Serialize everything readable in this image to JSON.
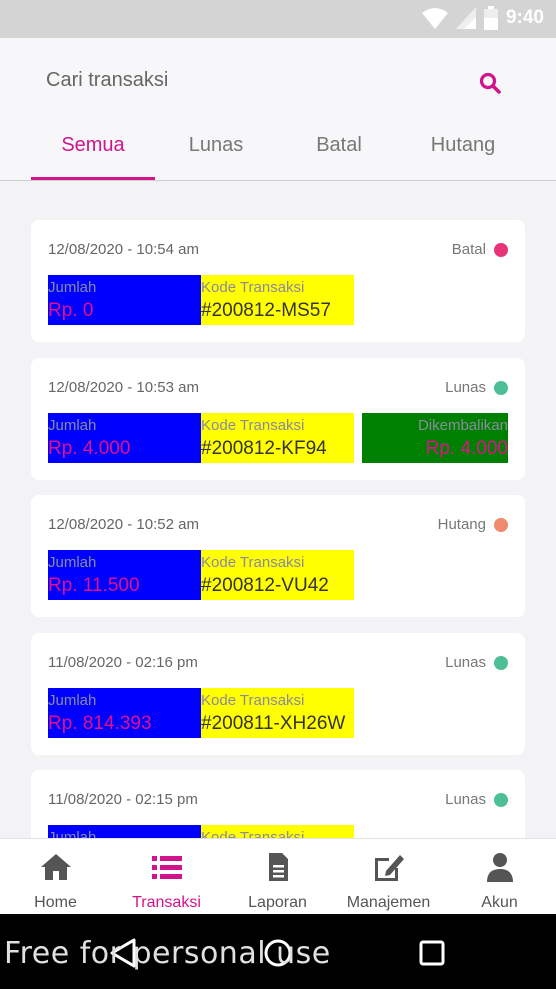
{
  "status_bar": {
    "time": "9:40"
  },
  "search": {
    "placeholder": "Cari transaksi"
  },
  "tabs": [
    {
      "label": "Semua",
      "active": true
    },
    {
      "label": "Lunas",
      "active": false
    },
    {
      "label": "Batal",
      "active": false
    },
    {
      "label": "Hutang",
      "active": false
    }
  ],
  "labels": {
    "amount": "Jumlah",
    "code": "Kode Transaksi",
    "returned": "Dikembalikan"
  },
  "transactions": [
    {
      "datetime": "12/08/2020 - 10:54 am",
      "status": "Batal",
      "status_color": "#e8337a",
      "amount": "Rp. 0",
      "code": "#200812-MS57"
    },
    {
      "datetime": "12/08/2020 - 10:53 am",
      "status": "Lunas",
      "status_color": "#4cbf95",
      "amount": "Rp. 4.000",
      "code": "#200812-KF94",
      "returned": "Rp. 4.000"
    },
    {
      "datetime": "12/08/2020 - 10:52 am",
      "status": "Hutang",
      "status_color": "#f08a6c",
      "amount": "Rp. 11.500",
      "code": "#200812-VU42"
    },
    {
      "datetime": "11/08/2020 - 02:16 pm",
      "status": "Lunas",
      "status_color": "#4cbf95",
      "amount": "Rp. 814.393",
      "code": "#200811-XH26W"
    },
    {
      "datetime": "11/08/2020 - 02:15 pm",
      "status": "Lunas",
      "status_color": "#4cbf95",
      "amount": "",
      "code": ""
    }
  ],
  "bottom_nav": [
    {
      "label": "Home",
      "icon": "home-icon",
      "active": false
    },
    {
      "label": "Transaksi",
      "icon": "list-icon",
      "active": true
    },
    {
      "label": "Laporan",
      "icon": "document-icon",
      "active": false
    },
    {
      "label": "Manajemen",
      "icon": "edit-icon",
      "active": false
    },
    {
      "label": "Akun",
      "icon": "user-icon",
      "active": false
    }
  ],
  "colors": {
    "accent": "#d1138c",
    "amount_box": "#0000ff",
    "code_box": "#ffff00",
    "returned_box": "#008000"
  },
  "watermark": "Free for personal use"
}
